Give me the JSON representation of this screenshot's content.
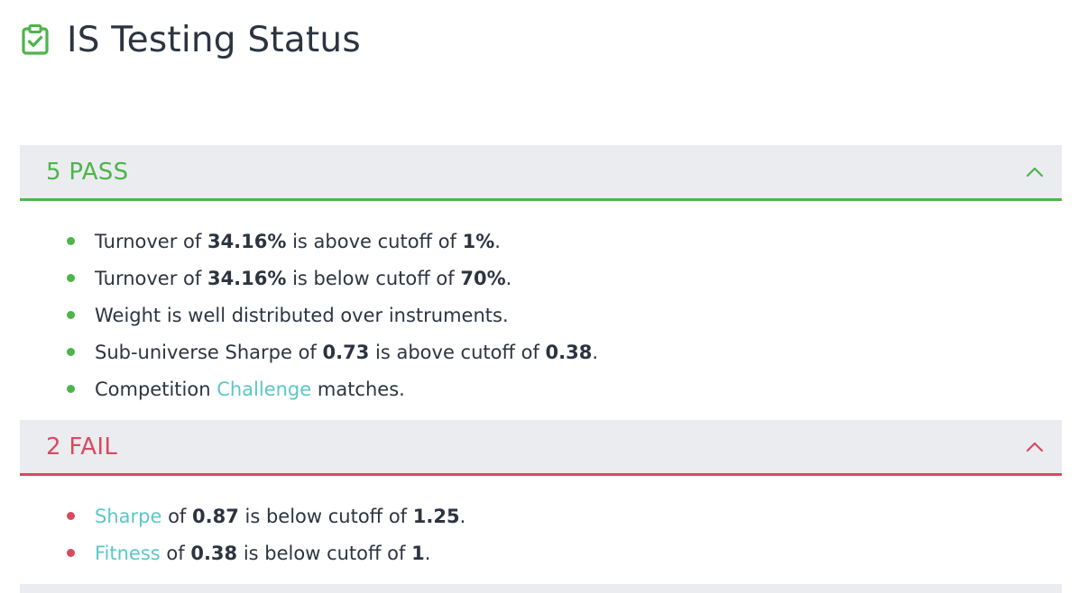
{
  "page": {
    "title": "IS Testing Status",
    "title_icon": "clipboard-check-icon"
  },
  "colors": {
    "pass": "#4cb54a",
    "fail": "#d84a60",
    "link": "#5bc7c9",
    "header_bg": "#ebecf0",
    "text": "#2d3440"
  },
  "pass_section": {
    "label": "5 PASS",
    "chevron_icon": "chevron-up-icon",
    "items": [
      {
        "parts": [
          {
            "t": "Turnover of "
          },
          {
            "t": "34.16%",
            "s": "bold"
          },
          {
            "t": " is above cutoff of "
          },
          {
            "t": "1%",
            "s": "bold"
          },
          {
            "t": "."
          }
        ]
      },
      {
        "parts": [
          {
            "t": "Turnover of "
          },
          {
            "t": "34.16%",
            "s": "bold"
          },
          {
            "t": " is below cutoff of "
          },
          {
            "t": "70%",
            "s": "bold"
          },
          {
            "t": "."
          }
        ]
      },
      {
        "parts": [
          {
            "t": "Weight is well distributed over instruments."
          }
        ]
      },
      {
        "parts": [
          {
            "t": "Sub-universe Sharpe of "
          },
          {
            "t": "0.73",
            "s": "bold"
          },
          {
            "t": " is above cutoff of "
          },
          {
            "t": "0.38",
            "s": "bold"
          },
          {
            "t": "."
          }
        ]
      },
      {
        "parts": [
          {
            "t": "Competition "
          },
          {
            "t": "Challenge",
            "s": "link"
          },
          {
            "t": " matches."
          }
        ]
      }
    ]
  },
  "fail_section": {
    "label": "2 FAIL",
    "chevron_icon": "chevron-up-icon",
    "items": [
      {
        "parts": [
          {
            "t": "Sharpe",
            "s": "link"
          },
          {
            "t": " of "
          },
          {
            "t": "0.87",
            "s": "bold"
          },
          {
            "t": " is below cutoff of "
          },
          {
            "t": "1.25",
            "s": "bold"
          },
          {
            "t": "."
          }
        ]
      },
      {
        "parts": [
          {
            "t": "Fitness",
            "s": "link"
          },
          {
            "t": " of "
          },
          {
            "t": "0.38",
            "s": "bold"
          },
          {
            "t": " is below cutoff of "
          },
          {
            "t": "1",
            "s": "bold"
          },
          {
            "t": "."
          }
        ]
      }
    ]
  }
}
